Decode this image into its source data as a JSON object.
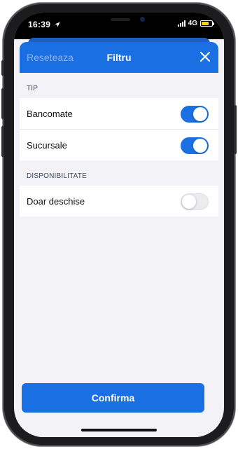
{
  "status_bar": {
    "time": "16:39",
    "network": "4G",
    "location_icon": "location-arrow-icon",
    "signal_icon": "signal-bars-icon",
    "battery_icon": "battery-icon",
    "battery_color": "#f5d60a"
  },
  "header": {
    "reset_label": "Reseteaza",
    "title": "Filtru",
    "close_icon": "close-icon"
  },
  "sections": [
    {
      "title": "TIP",
      "items": [
        {
          "label": "Bancomate",
          "enabled": true
        },
        {
          "label": "Sucursale",
          "enabled": true
        }
      ]
    },
    {
      "title": "DISPONIBILITATE",
      "items": [
        {
          "label": "Doar deschise",
          "enabled": false
        }
      ]
    }
  ],
  "confirm_label": "Confirma",
  "colors": {
    "accent": "#1a6fe3",
    "background": "#f2f2f7",
    "toggle_off": "#ececf0"
  }
}
